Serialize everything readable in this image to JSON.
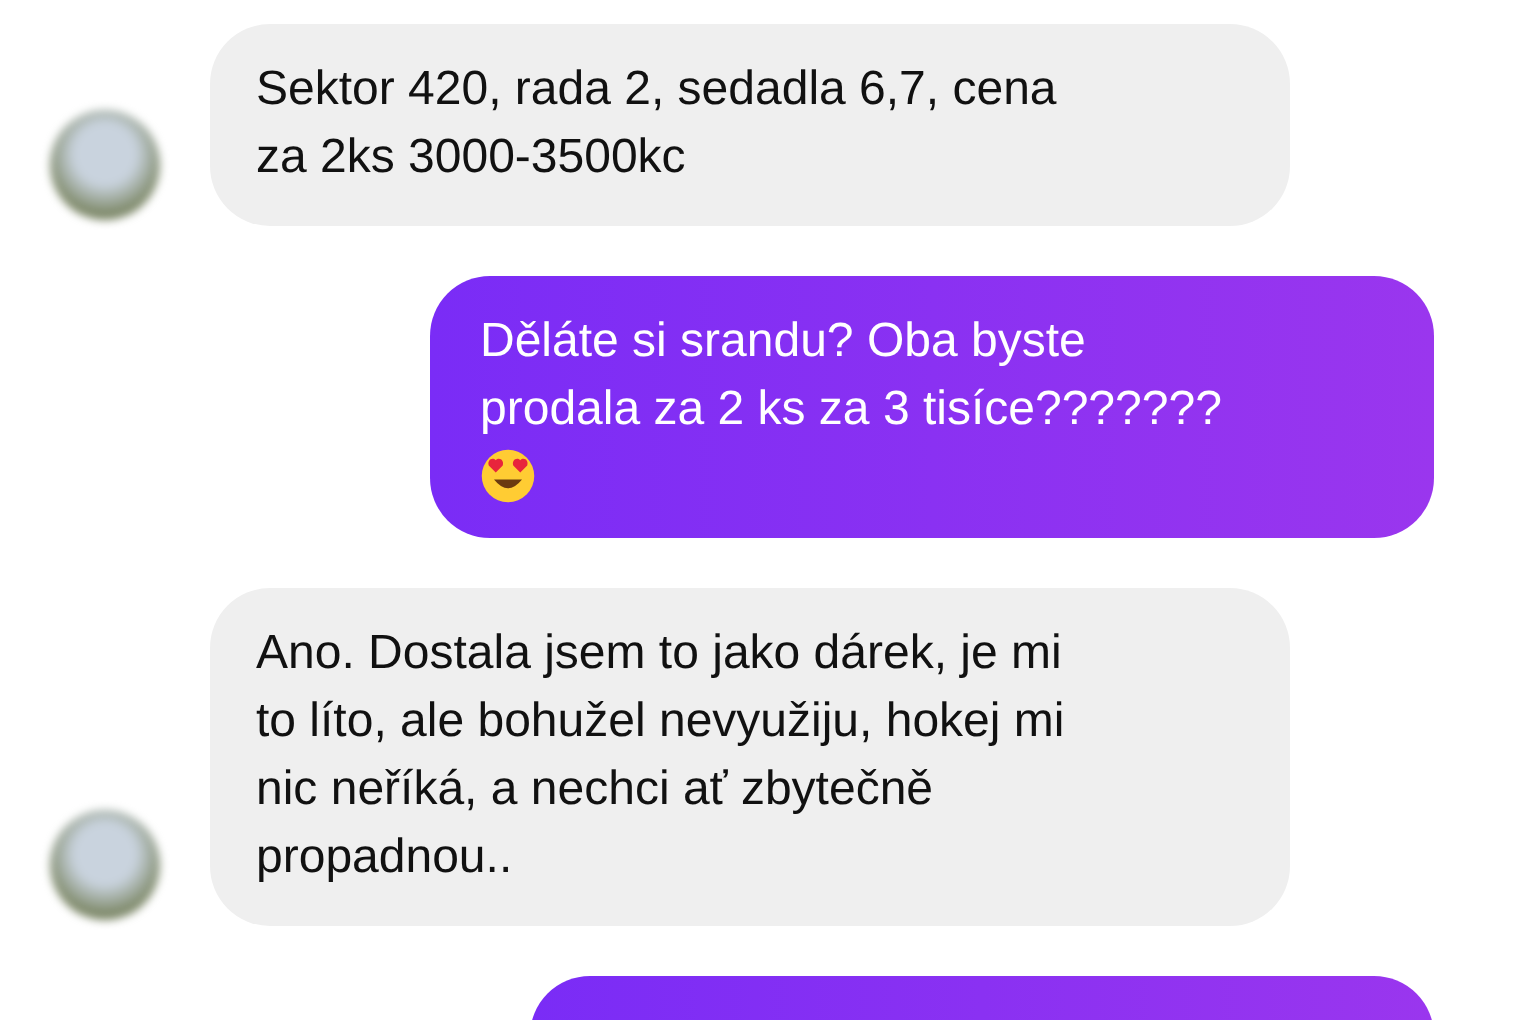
{
  "messages": [
    {
      "kind": "incoming",
      "text": "Sektor 420, rada 2, sedadla 6,7, cena\nza 2ks 3000-3500kc"
    },
    {
      "kind": "outgoing",
      "text": "Děláte si srandu? Oba byste\nprodala za 2 ks za 3 tisíce???????",
      "has_emoji": true
    },
    {
      "kind": "incoming",
      "text": "Ano. Dostala jsem to jako dárek, je mi\nto líto, ale bohužel nevyužiju, hokej mi\nnic neříká, a nechci ať zbytečně\npropadnou.."
    },
    {
      "kind": "outgoing"
    }
  ]
}
